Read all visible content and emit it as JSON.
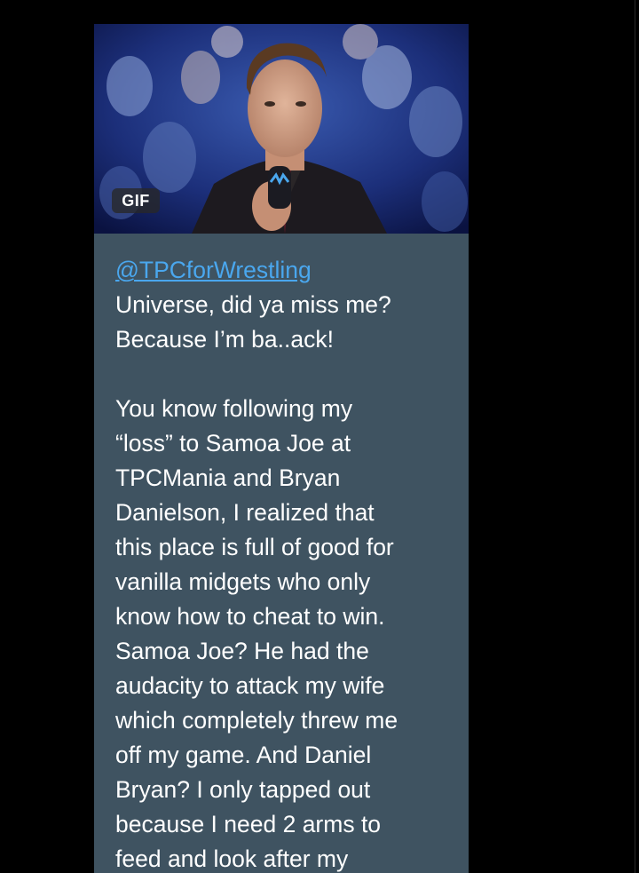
{
  "gif": {
    "badge_label": "GIF",
    "accent_color": "#4aa7ee"
  },
  "message": {
    "mention": "@TPCforWrestling",
    "lines": [
      "Universe, did ya miss me?",
      "Because I’m ba..ack!",
      "",
      "You know following my",
      "“loss” to Samoa Joe at",
      "TPCMania and Bryan",
      "Danielson, I realized that",
      "this place is full of good for",
      "vanilla midgets who only",
      "know how to cheat to win.",
      "Samoa Joe? He had the",
      "audacity to attack my wife",
      "which completely threw me",
      "off my game. And Daniel",
      "Bryan? I only tapped out",
      "because I need 2 arms to",
      "feed and look after my"
    ]
  },
  "colors": {
    "bubble": "#3f5361",
    "text": "#ffffff",
    "link": "#4aa7ee",
    "background": "#000000"
  }
}
